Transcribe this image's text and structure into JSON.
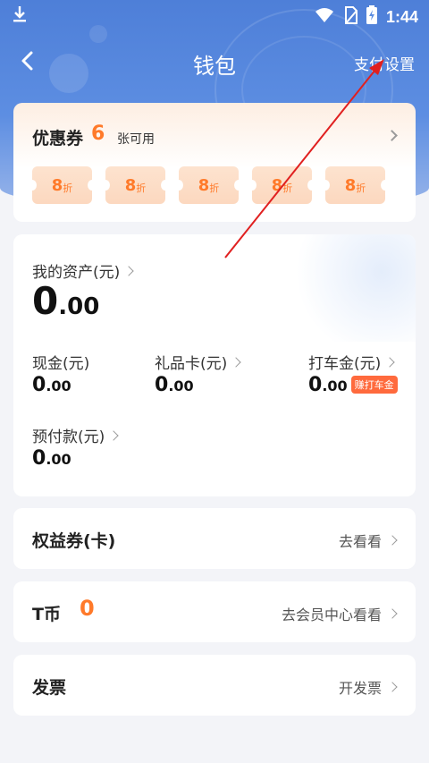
{
  "status_bar": {
    "time": "1:44",
    "icons": [
      "download-icon",
      "wifi-icon",
      "sim-icon",
      "battery-icon"
    ]
  },
  "nav": {
    "title": "钱包",
    "pay_settings": "支付设置"
  },
  "coupons": {
    "title": "优惠券",
    "count": "6",
    "available_text": "张可用",
    "tickets": [
      {
        "num": "8",
        "unit": "折"
      },
      {
        "num": "8",
        "unit": "折"
      },
      {
        "num": "8",
        "unit": "折"
      },
      {
        "num": "8",
        "unit": "折"
      },
      {
        "num": "8",
        "unit": "折"
      }
    ]
  },
  "assets": {
    "my_assets_label": "我的资产(元)",
    "total_int": "0",
    "total_dec": ".00",
    "cash": {
      "label": "现金(元)",
      "int": "0",
      "dec": ".00"
    },
    "gift_card": {
      "label": "礼品卡(元)",
      "int": "0",
      "dec": ".00"
    },
    "taxi_money": {
      "label": "打车金(元)",
      "int": "0",
      "dec": ".00",
      "badge": "赚打车金"
    },
    "prepaid": {
      "label": "预付款(元)",
      "int": "0",
      "dec": ".00"
    }
  },
  "rows": {
    "rights": {
      "title": "权益券(卡)",
      "action": "去看看"
    },
    "tcoin": {
      "title": "T币",
      "value": "0",
      "action": "去会员中心看看"
    },
    "invoice": {
      "title": "发票",
      "action": "开发票"
    }
  },
  "colors": {
    "accent": "#ff7a2a",
    "header_blue": "#5d8ee2",
    "annotation_red": "#e02020"
  }
}
